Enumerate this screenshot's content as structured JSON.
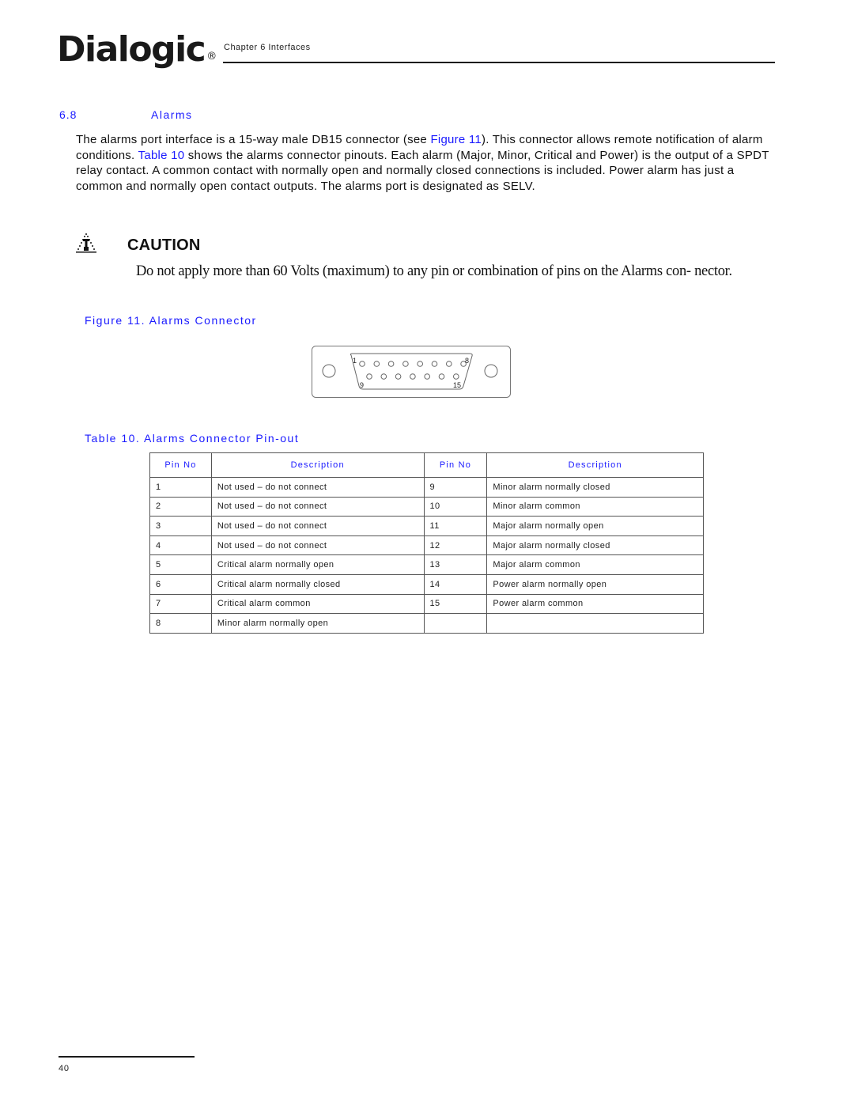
{
  "header": {
    "logo_text": "Dialogic",
    "logo_reg_mark": "®",
    "chapter": "Chapter 6 Interfaces"
  },
  "section": {
    "number": "6.8",
    "title": "Alarms",
    "paragraph": {
      "part1": "The alarms port interface is a 15-way male DB15 connector (see ",
      "link_figure": "Figure 11",
      "part2": "). This connector allows remote notification of alarm conditions. ",
      "link_table": "Table 10",
      "part3": " shows the alarms connector pinouts. Each alarm (Major, Minor, Critical and Power) is the output of a SPDT relay contact. A common contact with normally open and normally closed connections is included. Power alarm has just a common and normally open contact outputs. The alarms port is designated as SELV."
    }
  },
  "caution": {
    "icon": "caution-warning-triangle-icon",
    "title": "CAUTION",
    "text": "Do not apply more than 60 Volts (maximum) to any pin or combination of pins on the Alarms con- nector."
  },
  "figure": {
    "caption": "Figure 11. Alarms Connector",
    "connector": {
      "type": "DB15 male",
      "top_row_pins": 8,
      "bottom_row_pins": 7,
      "labels": {
        "top_left": "1",
        "top_right": "8",
        "bottom_left": "9",
        "bottom_right": "15"
      }
    }
  },
  "table": {
    "caption": "Table 10. Alarms Connector Pin-out",
    "headers": [
      "Pin No",
      "Description",
      "Pin No",
      "Description"
    ],
    "rows": [
      [
        "1",
        "Not used – do not connect",
        "9",
        "Minor alarm normally closed"
      ],
      [
        "2",
        "Not used – do not connect",
        "10",
        "Minor alarm common"
      ],
      [
        "3",
        "Not used – do not connect",
        "11",
        "Major alarm normally open"
      ],
      [
        "4",
        "Not used – do not connect",
        "12",
        "Major alarm normally closed"
      ],
      [
        "5",
        "Critical alarm normally open",
        "13",
        "Major alarm common"
      ],
      [
        "6",
        "Critical alarm normally closed",
        "14",
        "Power alarm normally open"
      ],
      [
        "7",
        "Critical alarm common",
        "15",
        "Power alarm common"
      ],
      [
        "8",
        "Minor alarm normally open",
        "",
        ""
      ]
    ]
  },
  "footer": {
    "page_number": "40"
  },
  "colors": {
    "link_blue": "#1a1aff",
    "text": "#111111"
  }
}
